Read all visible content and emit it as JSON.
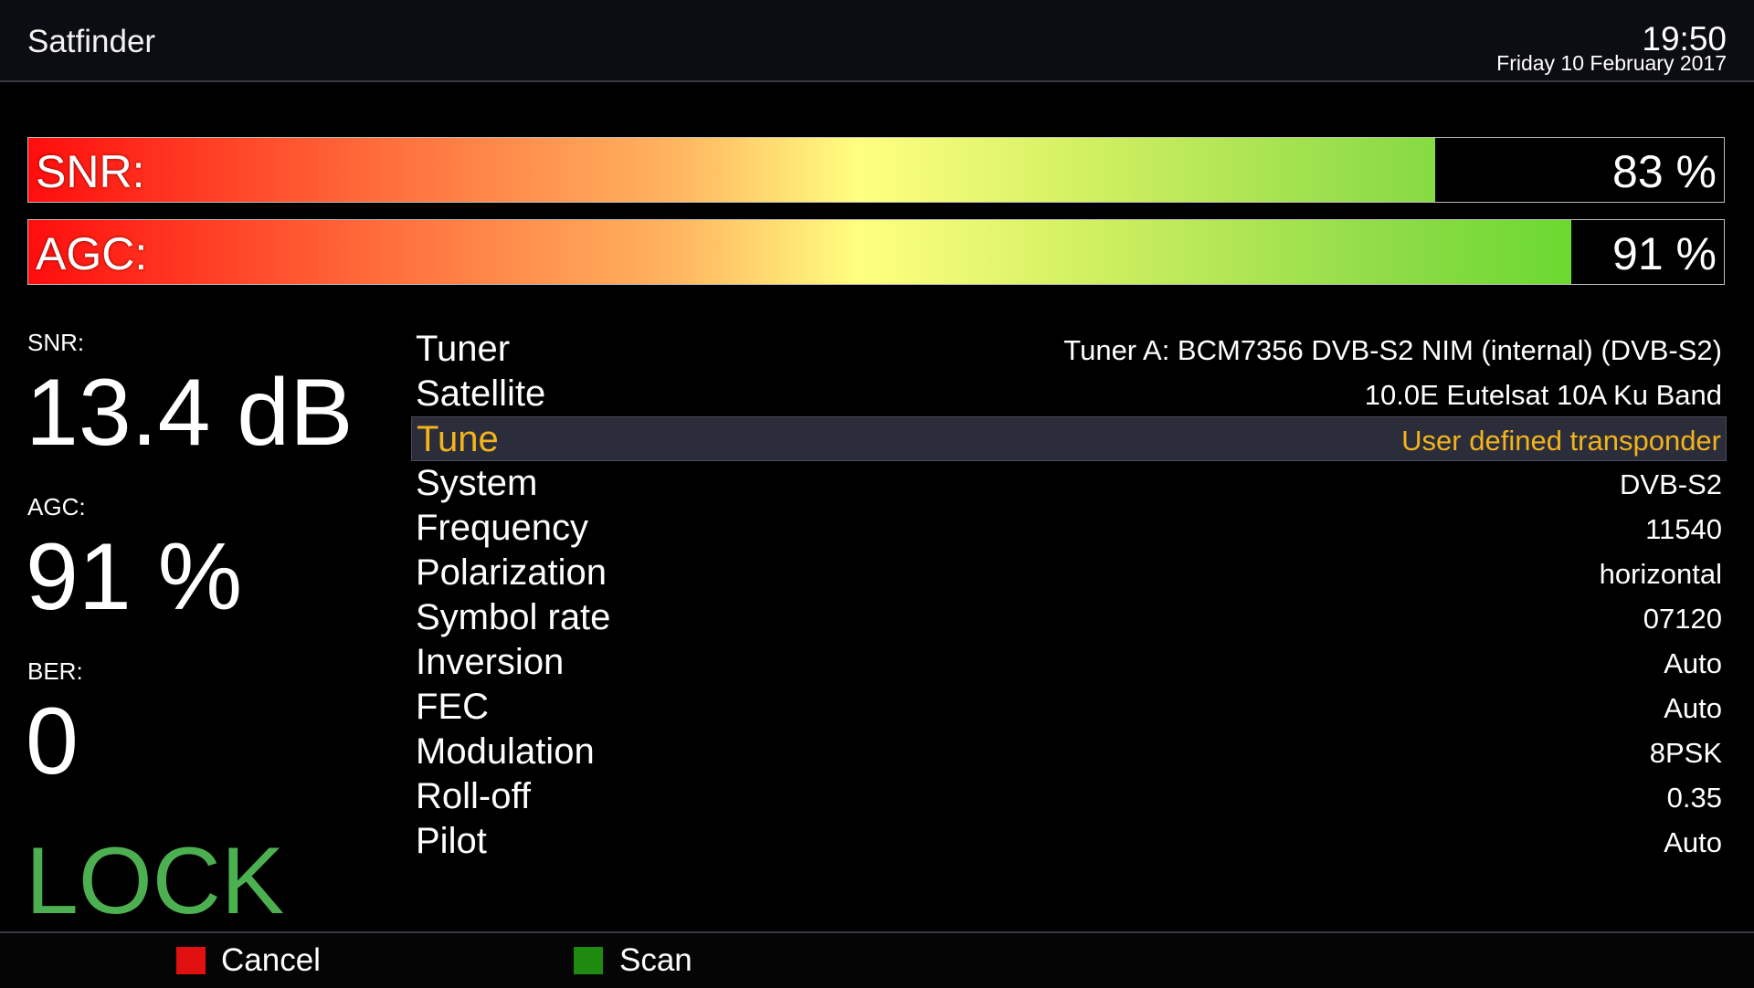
{
  "header": {
    "title": "Satfinder",
    "time": "19:50",
    "date": "Friday 10 February 2017"
  },
  "bars": [
    {
      "label": "SNR:",
      "value_text": "83 %",
      "level": 0.83
    },
    {
      "label": "AGC:",
      "value_text": "91 %",
      "level": 0.91
    }
  ],
  "stats": {
    "snr_label": "SNR:",
    "snr_value": "13.4 dB",
    "agc_label": "AGC:",
    "agc_value": "91 %",
    "ber_label": "BER:",
    "ber_value": "0",
    "lock_status": "LOCK"
  },
  "params": [
    {
      "name": "Tuner",
      "value": "Tuner A: BCM7356 DVB-S2 NIM (internal) (DVB-S2)"
    },
    {
      "name": "Satellite",
      "value": "10.0E Eutelsat 10A Ku Band"
    },
    {
      "name": "Tune",
      "value": "User defined transponder",
      "selected": true
    },
    {
      "name": "System",
      "value": "DVB-S2"
    },
    {
      "name": "Frequency",
      "value": "11540"
    },
    {
      "name": "Polarization",
      "value": "horizontal"
    },
    {
      "name": "Symbol rate",
      "value": "07120"
    },
    {
      "name": "Inversion",
      "value": "Auto"
    },
    {
      "name": "FEC",
      "value": "Auto"
    },
    {
      "name": "Modulation",
      "value": "8PSK"
    },
    {
      "name": "Roll-off",
      "value": "0.35"
    },
    {
      "name": "Pilot",
      "value": "Auto"
    }
  ],
  "footer": {
    "cancel_label": "Cancel",
    "scan_label": "Scan",
    "cancel_color": "#e01010",
    "scan_color": "#1f8a10"
  },
  "colors": {
    "lock": "#4cb050",
    "selected_text": "#f2b41c",
    "selected_bg": "#2c2d3b"
  }
}
